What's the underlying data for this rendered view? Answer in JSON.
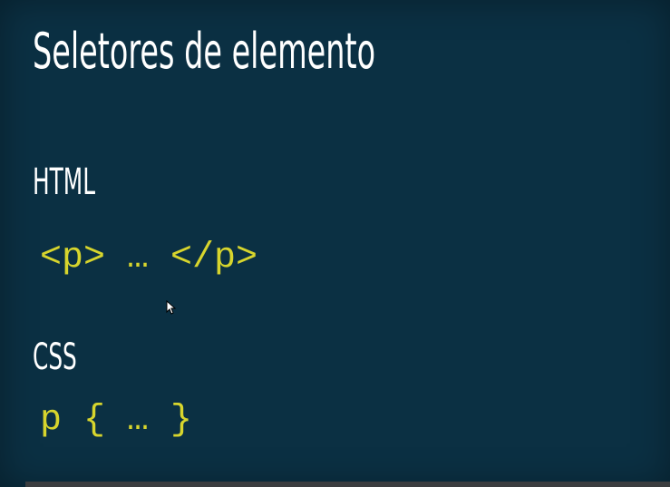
{
  "slide": {
    "title": "Seletores de elemento",
    "html_section": {
      "label": "HTML",
      "code": "<p> … </p>"
    },
    "css_section": {
      "label": "CSS",
      "code": "p { … }"
    }
  },
  "colors": {
    "background": "#0b3043",
    "text": "#ffffff",
    "code": "#d7d52d"
  },
  "icons": {
    "pointer": "mouse-pointer-icon"
  }
}
